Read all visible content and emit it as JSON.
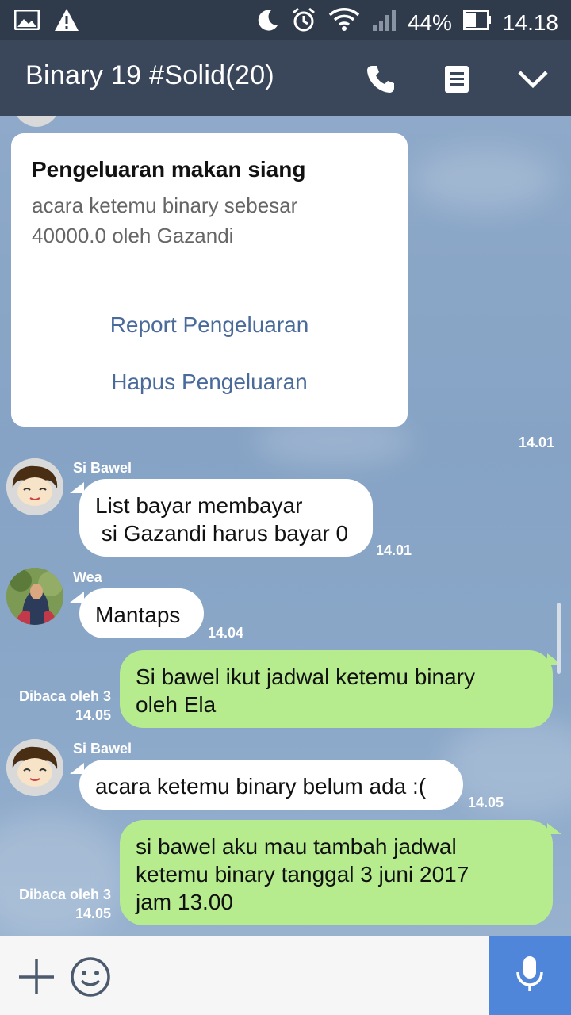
{
  "status_bar": {
    "battery": "44%",
    "time": "14.18",
    "icons": [
      "image-icon",
      "warning-icon",
      "moon-icon",
      "alarm-icon",
      "wifi-icon",
      "signal-icon",
      "battery-icon"
    ]
  },
  "header": {
    "title": "Binary 19 #Solid(20)",
    "icons": [
      "phone-icon",
      "notes-icon",
      "chevron-down-icon"
    ]
  },
  "card": {
    "title": "Pengeluaran makan siang",
    "body": "acara ketemu binary sebesar 40000.0 oleh Gazandi",
    "actions": [
      "Report Pengeluaran",
      "Hapus Pengeluaran"
    ],
    "time": "14.01"
  },
  "messages": [
    {
      "sender": "Si Bawel",
      "text": "List bayar membayar\n si Gazandi harus bayar 0",
      "time": "14.01",
      "direction": "in"
    },
    {
      "sender": "Wea",
      "text": "Mantaps",
      "time": "14.04",
      "direction": "in"
    },
    {
      "text": "Si bawel ikut jadwal ketemu binary\noleh Ela",
      "read": "Dibaca oleh 3",
      "time": "14.05",
      "direction": "out"
    },
    {
      "sender": "Si Bawel",
      "text": "acara ketemu binary belum ada :(",
      "time": "14.05",
      "direction": "in"
    },
    {
      "text": "si bawel aku mau tambah jadwal\nketemu binary tanggal 3 juni 2017\njam 13.00",
      "read": "Dibaca oleh 3",
      "time": "14.05",
      "direction": "out"
    }
  ],
  "input_bar": {
    "icons": [
      "plus-icon",
      "emoji-icon",
      "microphone-icon"
    ],
    "accent": "#4f86d9"
  },
  "colors": {
    "header": "#3a475b",
    "status_bar": "#2f3a4b",
    "outgoing_bubble": "#b6ec8d",
    "chat_background": "#8aa5c6",
    "link": "#4a6b9a"
  }
}
